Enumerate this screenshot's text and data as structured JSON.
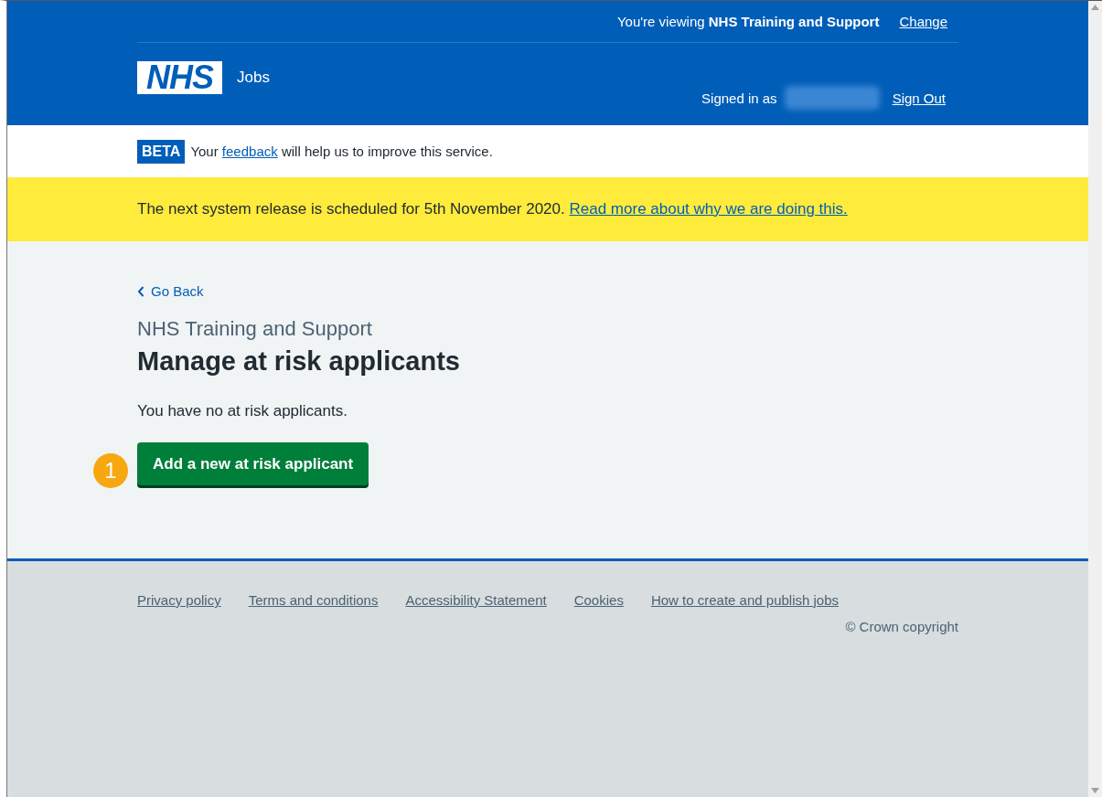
{
  "header": {
    "viewing_prefix": "You're viewing ",
    "viewing_org": "NHS Training and Support",
    "change_link": "Change",
    "logo": "NHS",
    "service": "Jobs",
    "signed_in_label": "Signed in as",
    "sign_out_link": "Sign Out"
  },
  "beta_banner": {
    "tag": "BETA",
    "before": "Your ",
    "link": "feedback",
    "after": " will help us to improve this service."
  },
  "notice": {
    "text": "The next system release is scheduled for 5th November 2020.",
    "link": "Read more about why we are doing this."
  },
  "back_link": "Go Back",
  "caption": "NHS Training and Support",
  "heading": "Manage at risk applicants",
  "body": "You have no at risk applicants.",
  "callout": "1",
  "primary_button": "Add a new at risk applicant",
  "footer": {
    "links": [
      "Privacy policy",
      "Terms and conditions",
      "Accessibility Statement",
      "Cookies",
      "How to create and publish jobs"
    ],
    "copyright": "© Crown copyright"
  }
}
